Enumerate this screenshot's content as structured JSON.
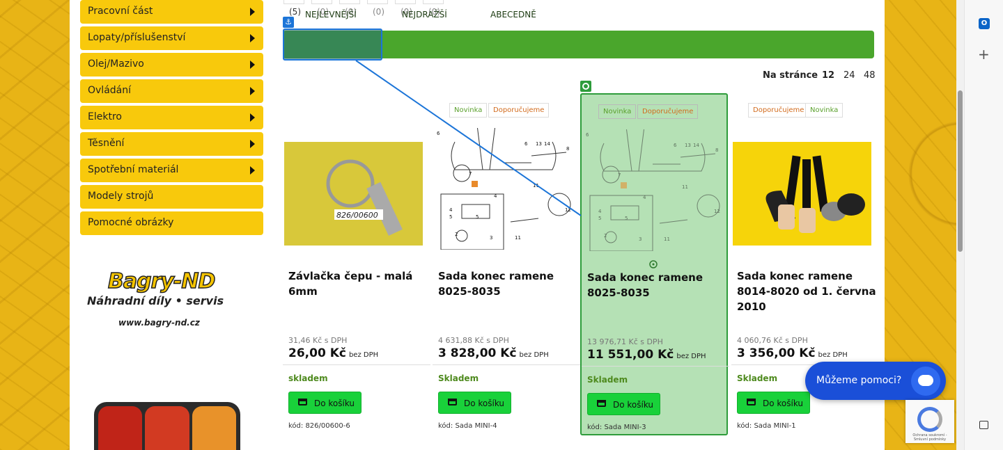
{
  "sidebar": {
    "categories": [
      {
        "label": "Pracovní část",
        "has_arrow": true
      },
      {
        "label": "Lopaty/příslušenství",
        "has_arrow": true
      },
      {
        "label": "Olej/Mazivo",
        "has_arrow": true
      },
      {
        "label": "Ovládání",
        "has_arrow": true
      },
      {
        "label": "Elektro",
        "has_arrow": true
      },
      {
        "label": "Těsnění",
        "has_arrow": true
      },
      {
        "label": "Spotřební materiál",
        "has_arrow": true
      },
      {
        "label": "Modely strojů",
        "has_arrow": false
      },
      {
        "label": "Pomocné obrázky",
        "has_arrow": false
      }
    ],
    "logo": {
      "name": "Bagry-ND",
      "tagline": "Náhradní díly • servis",
      "url": "www.bagry-nd.cz"
    }
  },
  "ratings": [
    "(5)",
    "(0)",
    "(0)",
    "(0)",
    "(0)",
    "(0)"
  ],
  "sort": {
    "options": [
      "NEJLEVNĚJŠÍ",
      "NEJDRAŽŠÍ",
      "ABECEDNĚ"
    ],
    "active": "NEJLEVNĚJŠÍ"
  },
  "per_page": {
    "label": "Na stránce",
    "options": [
      "12",
      "24",
      "48"
    ],
    "selected": "12"
  },
  "products": [
    {
      "tags": [],
      "name": "Závlačka čepu - malá 6mm",
      "price_vat": "31,46 Kč s DPH",
      "price": "26,00 Kč",
      "price_suffix": "bez DPH",
      "stock": "skladem",
      "cart": "Do košíku",
      "code": "kód: 826/00600-6",
      "image_label": "826/00600"
    },
    {
      "tags": [
        {
          "text": "Novinka",
          "color": "green"
        },
        {
          "text": "Doporučujeme",
          "color": "orange"
        }
      ],
      "name": "Sada konec ramene 8025-8035",
      "price_vat": "4 631,88 Kč s DPH",
      "price": "3 828,00 Kč",
      "price_suffix": "bez DPH",
      "stock": "Skladem",
      "cart": "Do košíku",
      "code": "kód: Sada MINI-4"
    },
    {
      "tags": [
        {
          "text": "Novinka",
          "color": "green"
        },
        {
          "text": "Doporučujeme",
          "color": "orange"
        }
      ],
      "name": "Sada konec ramene 8025-8035",
      "price_vat": "13 976,71 Kč s DPH",
      "price": "11 551,00 Kč",
      "price_suffix": "bez DPH",
      "stock": "Skladem",
      "cart": "Do košíku",
      "code": "kód: Sada MINI-3"
    },
    {
      "tags": [
        {
          "text": "Doporučujeme",
          "color": "orange"
        },
        {
          "text": "Novinka",
          "color": "green"
        }
      ],
      "name": "Sada konec ramene 8014-8020 od 1. června 2010",
      "price_vat": "4 060,76 Kč s DPH",
      "price": "3 356,00 Kč",
      "price_suffix": "bez DPH",
      "stock": "Skladem",
      "cart": "Do košíku",
      "code": "kód: Sada MINI-1"
    }
  ],
  "chat": {
    "label": "Můžeme pomoci?"
  },
  "recaptcha": {
    "text": "Ochrana soukromí - Smluvní podmínky"
  },
  "colors": {
    "accent_yellow": "#f8c90c",
    "sort_bar": "#4aa62c",
    "cart_button": "#19d13a",
    "chat": "#1a4fd8"
  }
}
